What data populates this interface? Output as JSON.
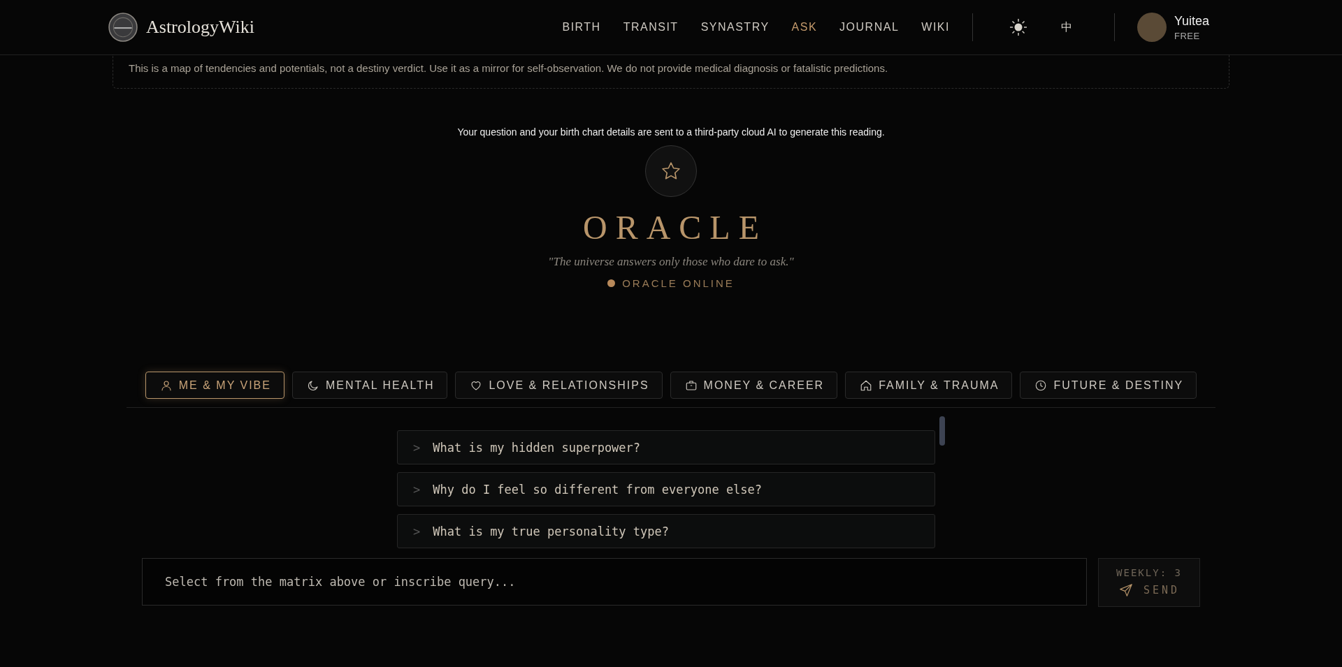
{
  "header": {
    "logo_text": "AstrologyWiki",
    "nav": [
      {
        "label": "BIRTH",
        "selected": false
      },
      {
        "label": "TRANSIT",
        "selected": false
      },
      {
        "label": "SYNASTRY",
        "selected": false
      },
      {
        "label": "ASK",
        "selected": true
      },
      {
        "label": "JOURNAL",
        "selected": false
      },
      {
        "label": "WIKI",
        "selected": false
      }
    ],
    "language": "中",
    "user": {
      "name": "Yuitea",
      "plan": "FREE"
    }
  },
  "disclaimer": "This is a map of tendencies and potentials, not a destiny verdict. Use it as a mirror for self-observation. We do not provide medical diagnosis or fatalistic predictions.",
  "oracle": {
    "notice": "Your question and your birth chart details are sent to a third-party cloud AI to generate this reading.",
    "title": "ORACLE",
    "quote": "\"The universe answers only those who dare to ask.\"",
    "status": "ORACLE ONLINE",
    "online": true
  },
  "categories": [
    {
      "label": "ME & MY VIBE",
      "selected": true
    },
    {
      "label": "MENTAL HEALTH",
      "selected": false
    },
    {
      "label": "LOVE & RELATIONSHIPS",
      "selected": false
    },
    {
      "label": "MONEY & CAREER",
      "selected": false
    },
    {
      "label": "FAMILY & TRAUMA",
      "selected": false
    },
    {
      "label": "FUTURE & DESTINY",
      "selected": false
    }
  ],
  "questions": [
    {
      "prompt": ">",
      "text": "What is my hidden superpower?"
    },
    {
      "prompt": ">",
      "text": "Why do I feel so different from everyone else?"
    },
    {
      "prompt": ">",
      "text": "What is my true personality type?"
    }
  ],
  "composer": {
    "placeholder": "Select from the matrix above or inscribe query...",
    "quota": "WEEKLY: 3",
    "send": "SEND"
  }
}
